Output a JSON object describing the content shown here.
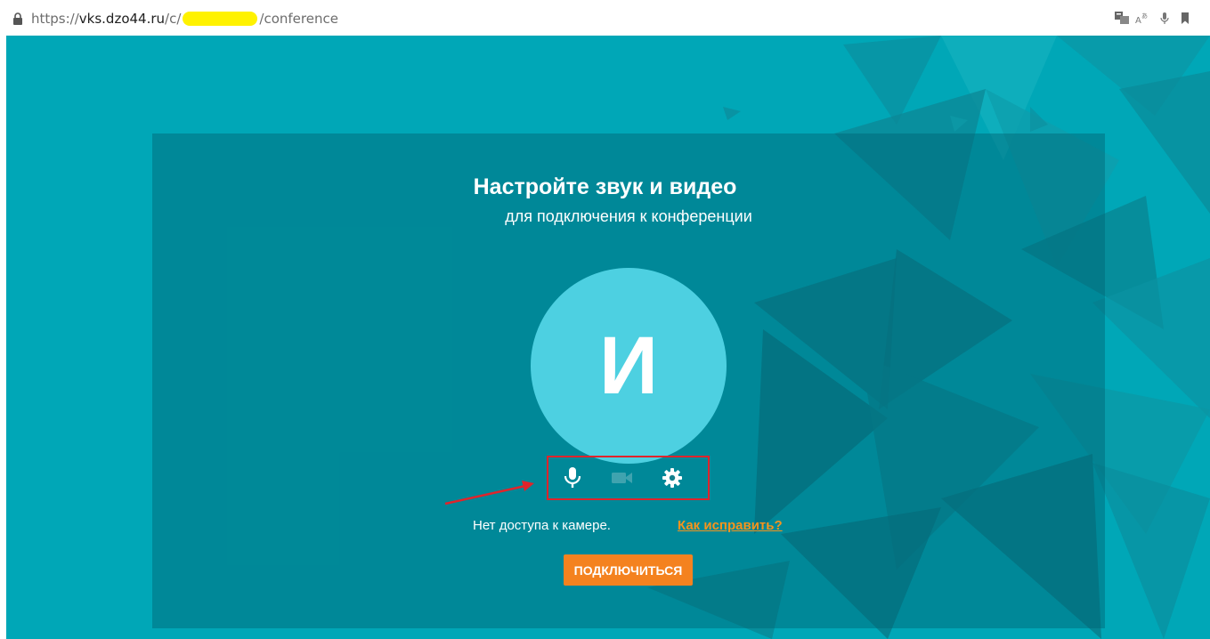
{
  "browser": {
    "url_scheme": "https://",
    "url_host": "vks.dzo44.ru",
    "url_path_start": "/c/",
    "url_path_end": "/conference"
  },
  "setup": {
    "title": "Настройте звук и видео",
    "subtitle": "для подключения к конференции",
    "avatar_initial": "И",
    "camera_status": "Нет доступа к камере.",
    "fix_link": "Как исправить?",
    "connect_button": "ПОДКЛЮЧИТЬСЯ"
  },
  "colors": {
    "background": "#00a7b7",
    "avatar": "#4dd0e1",
    "accent_orange": "#f4821f",
    "annotation_red": "#e0242b"
  },
  "icons": [
    "lock-icon",
    "microphone-icon",
    "camera-icon",
    "gear-icon",
    "translate-icon",
    "read-aloud-icon",
    "bookmark-icon"
  ]
}
